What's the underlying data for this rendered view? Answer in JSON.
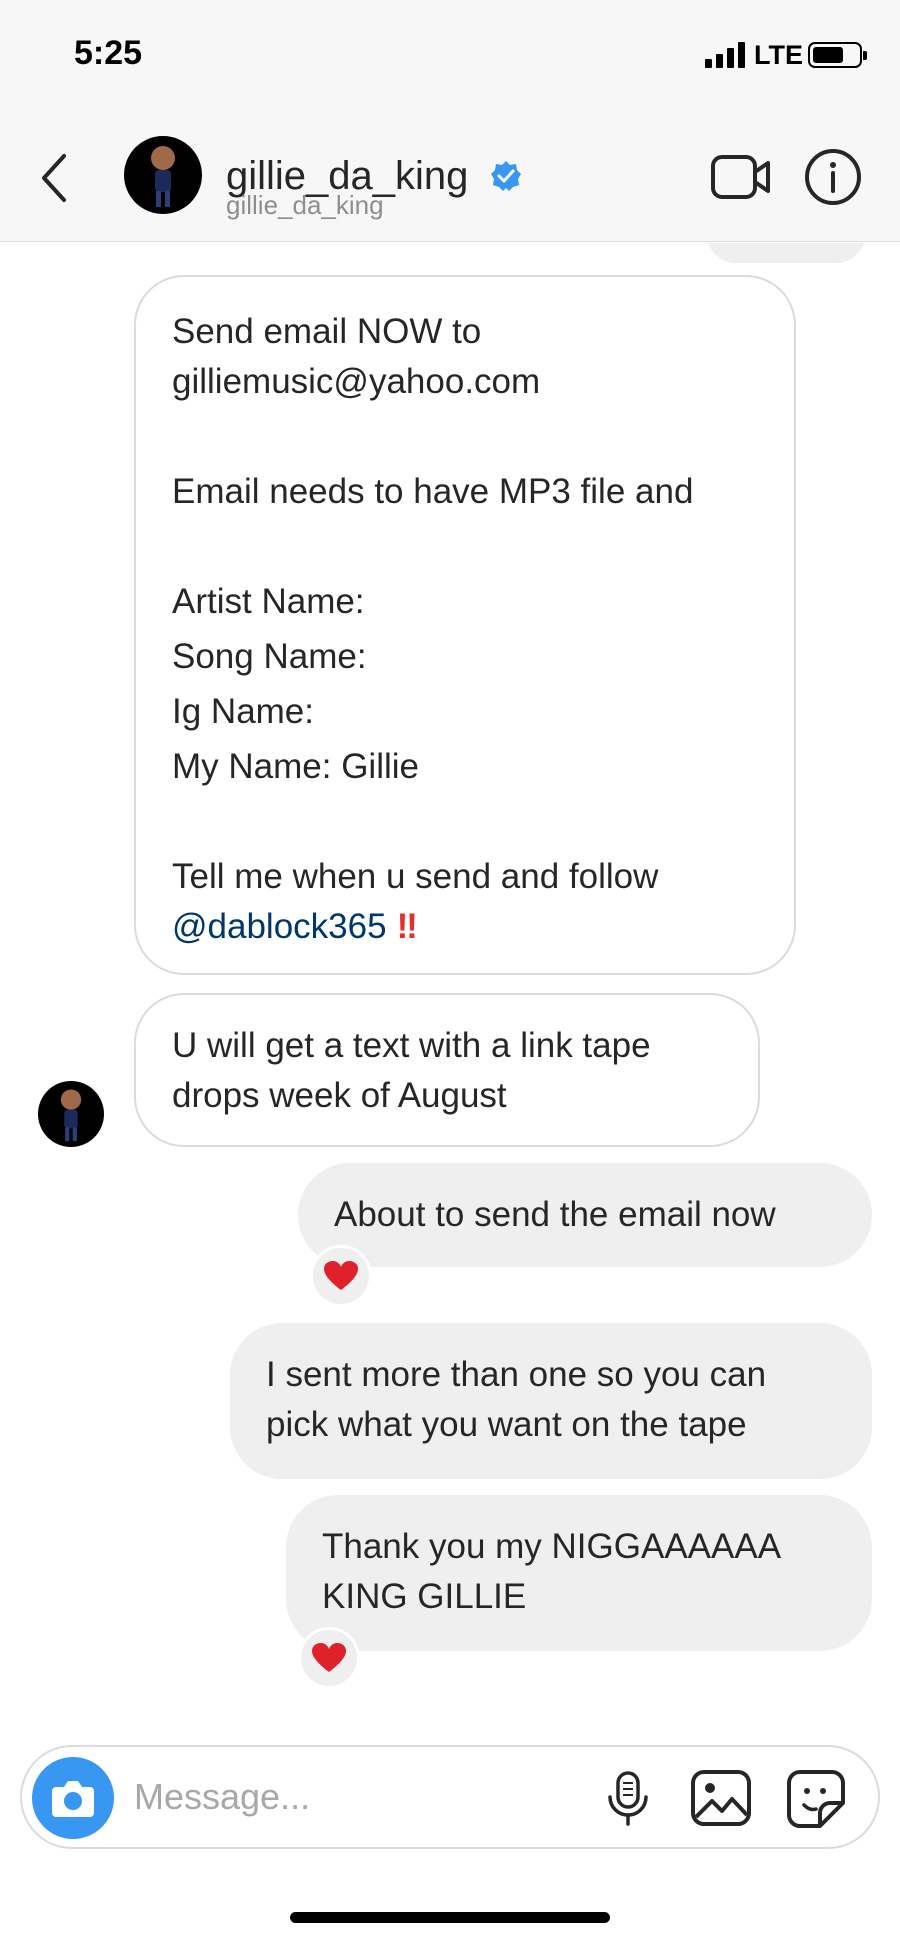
{
  "status_bar": {
    "time": "5:25",
    "network": "LTE"
  },
  "header": {
    "username": "gillie_da_king",
    "subtitle": "gillie_da_king",
    "verified": true,
    "icons": [
      "back-chevron-icon",
      "verified-badge-icon",
      "video-call-icon",
      "info-icon"
    ]
  },
  "messages": [
    {
      "direction": "incoming",
      "lines": [
        "Send email NOW to",
        "gilliemusic@yahoo.com"
      ],
      "lines2": [
        "Email needs to have MP3 file and"
      ],
      "lines3": [
        "Artist Name:",
        "Song Name:",
        "Ig Name:",
        "My Name: Gillie"
      ],
      "lines4": [
        "Tell me when u send and follow"
      ],
      "mention": "@dablock365",
      "emoji": "‼"
    },
    {
      "direction": "incoming",
      "lines": [
        "U will get a text with a link tape",
        "drops week of August"
      ]
    },
    {
      "direction": "outgoing",
      "lines": [
        "About to send the email now"
      ],
      "reaction": "❤️"
    },
    {
      "direction": "outgoing",
      "lines": [
        "I sent more than one so you can",
        "pick what you want on the tape"
      ]
    },
    {
      "direction": "outgoing",
      "lines": [
        "Thank you my NIGGAAAAAA",
        "KING GILLIE"
      ],
      "reaction": "❤️"
    }
  ],
  "composer": {
    "placeholder": "Message...",
    "icons": [
      "camera-icon",
      "microphone-icon",
      "gallery-icon",
      "sticker-icon"
    ]
  },
  "colors": {
    "accent_blue": "#3897f0",
    "mention_blue": "#00376b",
    "bubble_out": "#efefef",
    "header_bg": "#f7f7f7"
  }
}
